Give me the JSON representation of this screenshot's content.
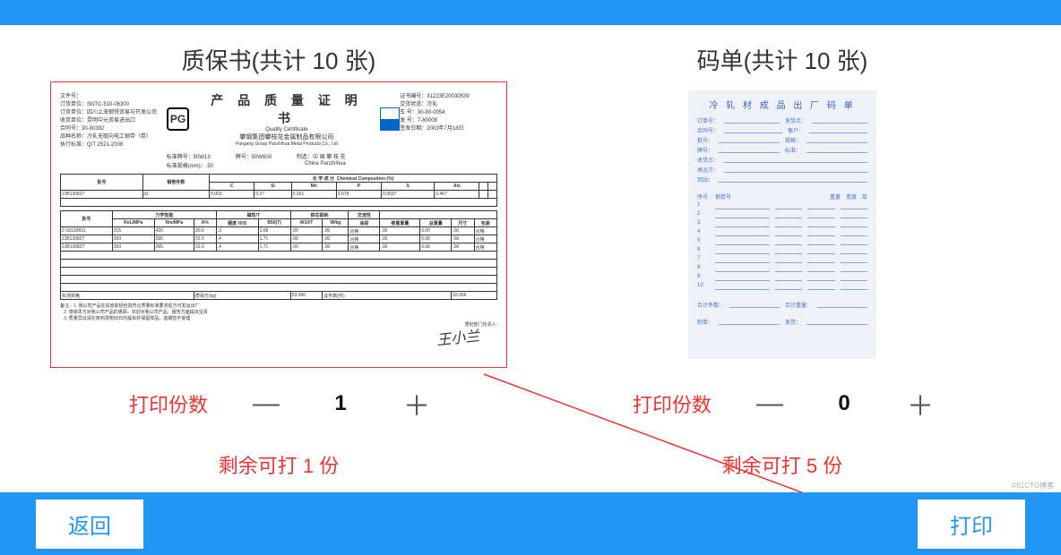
{
  "left": {
    "title": "质保书(共计 10 张)",
    "doc_title": "产 品 质 量 证 明 书",
    "doc_sub": "Quality Certificate",
    "company": "攀钢集团攀枝花金属制品有限公司",
    "company_en": "Pangang Group Panzhihua Metal Products Co., Ltd",
    "stepper_label": "打印份数",
    "count": "1",
    "remain": "剩余可打 1 份"
  },
  "right": {
    "title": "码单(共计 10 张)",
    "scan_title": "冷 轧 材 成 品 出 厂 码 单",
    "stepper_label": "打印份数",
    "count": "0",
    "remain": "剩余可打 5 份"
  },
  "buttons": {
    "back": "返回",
    "print": "打印"
  },
  "watermark": "©51CTO博客"
}
